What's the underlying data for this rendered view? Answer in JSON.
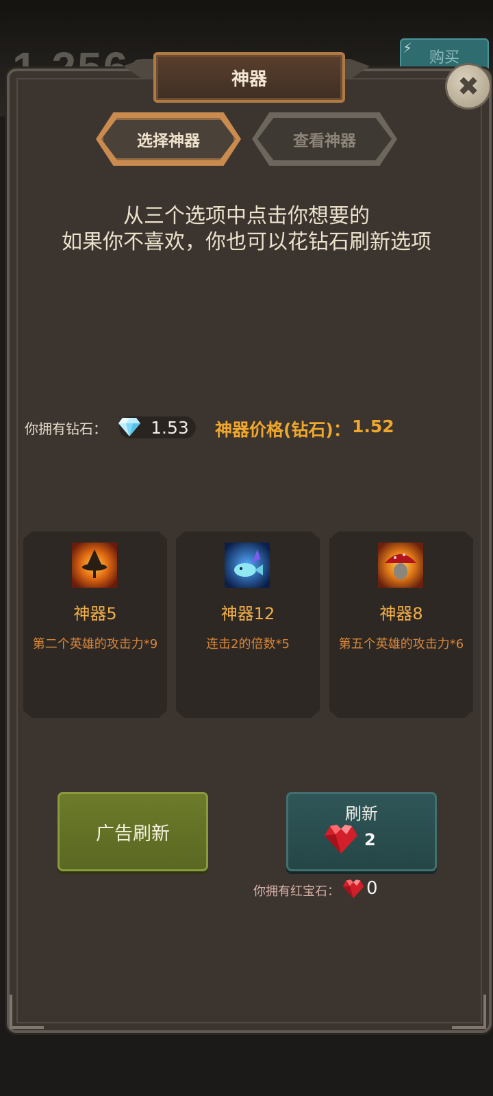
{
  "background": {
    "score_text": "1.256e7",
    "buy_label": "购买"
  },
  "dialog": {
    "title": "神器",
    "close_icon": "close-icon",
    "tabs": [
      {
        "label": "选择神器",
        "active": true
      },
      {
        "label": "查看神器",
        "active": false
      }
    ],
    "instructions": [
      "从三个选项中点击你想要的",
      "如果你不喜欢，你也可以花钻石刷新选项"
    ],
    "diamonds": {
      "own_label": "你拥有钻石：",
      "own_value": "1.53",
      "price_label": "神器价格(钻石)：",
      "price_value": "1.52"
    },
    "cards": [
      {
        "name": "神器5",
        "desc": "第二个英雄的攻击力*9",
        "icon": "witch-hat-icon"
      },
      {
        "name": "神器12",
        "desc": "连击2的倍数*5",
        "icon": "crystal-fish-icon"
      },
      {
        "name": "神器8",
        "desc": "第五个英雄的攻击力*6",
        "icon": "mushroom-icon"
      }
    ],
    "ad_refresh_label": "广告刷新",
    "refresh": {
      "label": "刷新",
      "cost": "2",
      "own_label": "你拥有红宝石：",
      "own_value": "0"
    }
  },
  "colors": {
    "panel": "#3b342f",
    "accent_gold": "#f0a82c",
    "ad_button": "#6d7b2b",
    "refresh_button": "#2f5658"
  }
}
